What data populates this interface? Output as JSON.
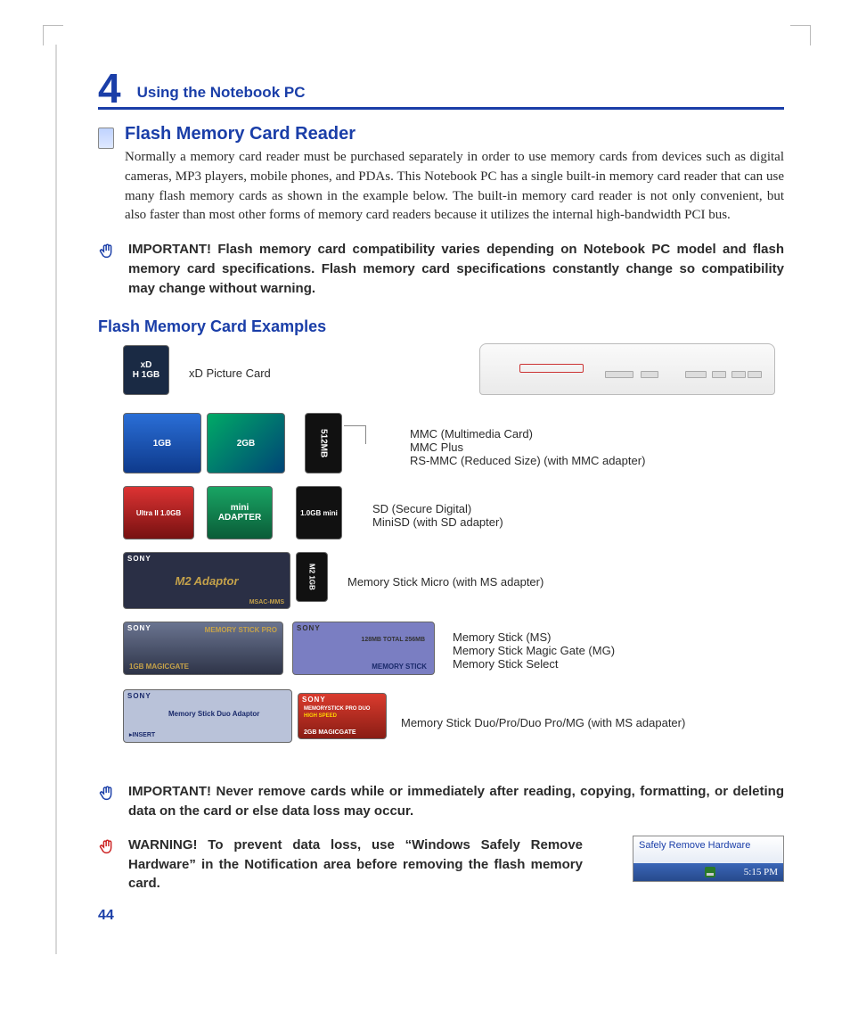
{
  "chapter": {
    "number": "4",
    "title": "Using the Notebook PC"
  },
  "section": {
    "title": "Flash Memory Card Reader",
    "body": "Normally a memory card reader must be purchased separately in order to use memory cards from devices such as digital cameras, MP3 players, mobile phones, and PDAs. This Notebook PC has a single built-in memory card reader that can use many flash memory cards as shown in the example below. The built-in memory card reader is not only convenient, but also faster than most other forms of memory card readers because it utilizes the internal high-bandwidth PCI bus."
  },
  "important1": "IMPORTANT! Flash memory card compatibility varies depending on Notebook PC model and flash memory card specifications. Flash memory card specifications constantly change so compatibility may change without warning.",
  "examples_heading": "Flash Memory Card Examples",
  "labels": {
    "xd": "xD Picture Card",
    "mmc_lines": "MMC (Multimedia Card)\nMMC Plus\nRS-MMC (Reduced Size) (with MMC adapter)",
    "sd_lines": "SD (Secure Digital)\nMiniSD (with SD adapter)",
    "msmicro": "Memory Stick Micro (with MS adapter)",
    "ms_lines": "Memory Stick (MS)\nMemory Stick Magic Gate (MG)\nMemory Stick Select",
    "msduo": "Memory Stick Duo/Pro/Duo Pro/MG (with MS adapater)"
  },
  "card_text": {
    "mmc1": "1GB",
    "mmc2": "2GB",
    "rsmmc": "512MB",
    "sd1": "Ultra II 1.0GB",
    "sd2": "mini",
    "minisd": "1.0GB mini",
    "m2adaptor": "M2 Adaptor",
    "m2adaptor_sub": "MSAC-MMS",
    "m2": "M2 1GB",
    "mspro": "MEMORY STICK PRO",
    "mspro_sub": "1GB  MAGICGATE",
    "ms": "MEMORY STICK",
    "ms_sub": "128MB  TOTAL 256MB",
    "msduo": "Memory Stick Duo Adaptor",
    "msduo_sub": "INSERT",
    "msproduo": "MEMORYSTICK PRO DUO",
    "msproduo_sub": "2GB  MAGICGATE",
    "sony": "SONY"
  },
  "important2": "IMPORTANT!  Never remove cards while or immediately after reading, copying, formatting, or deleting data on the card or else data loss may occur.",
  "warning": "WARNING! To prevent data loss, use “Windows Safely Remove Hardware” in the Notification area before removing the flash memory card.",
  "tray": {
    "title": "Safely Remove Hardware",
    "time": "5:15 PM"
  },
  "page_number": "44"
}
